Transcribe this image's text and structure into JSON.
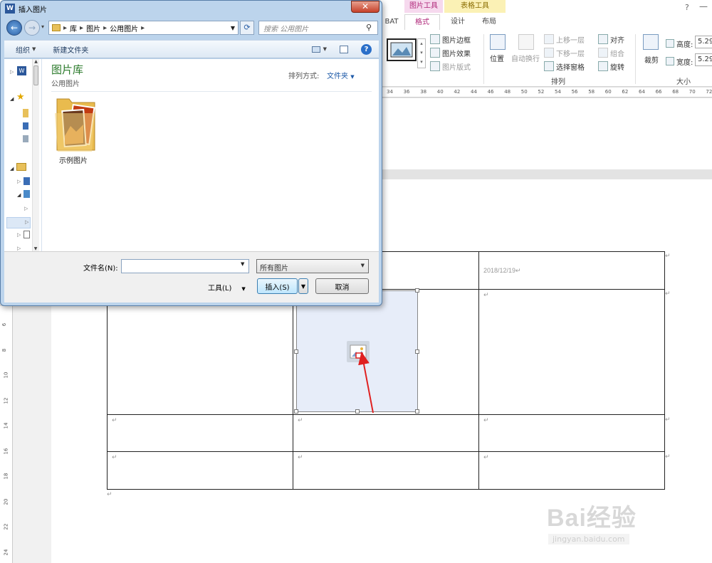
{
  "ribbon": {
    "context_picture_tools": "图片工具",
    "context_table_tools": "表格工具",
    "tabs": {
      "bat": "BAT",
      "format": "格式",
      "design": "设计",
      "layout": "布局"
    },
    "help": "?",
    "picture_border": "图片边框",
    "picture_effects": "图片效果",
    "picture_layout": "图片版式",
    "position": "位置",
    "wrap_text": "自动换行",
    "bring_forward": "上移一层",
    "send_backward": "下移一层",
    "selection_pane": "选择窗格",
    "align": "对齐",
    "group": "组合",
    "rotate": "旋转",
    "arrange_label": "排列",
    "crop": "裁剪",
    "height_label": "高度:",
    "width_label": "宽度:",
    "height_value": "5.29",
    "width_value": "5.29",
    "size_label": "大小"
  },
  "ruler": {
    "h_numbers": [
      "34",
      "36",
      "38",
      "40",
      "42",
      "44",
      "46",
      "48",
      "50",
      "52",
      "54",
      "56",
      "58",
      "60",
      "62",
      "64",
      "66",
      "68",
      "70",
      "72"
    ],
    "v_numbers": [
      "6",
      "8",
      "10",
      "12",
      "14",
      "16",
      "18",
      "20",
      "22",
      "24"
    ]
  },
  "document": {
    "date_text": "2018/12/19",
    "para_mark": "↵"
  },
  "dialog": {
    "title": "插入图片",
    "breadcrumb": [
      "库",
      "图片",
      "公用图片"
    ],
    "search_placeholder": "搜索 公用图片",
    "organize": "组织",
    "new_folder": "新建文件夹",
    "library_title": "图片库",
    "library_subtitle": "公用图片",
    "sort_label": "排列方式:",
    "sort_value": "文件夹",
    "folder_name": "示例图片",
    "filename_label": "文件名(N):",
    "filename_value": "",
    "filter_value": "所有图片",
    "tools_label": "工具(L)",
    "insert_label": "插入(S)",
    "cancel_label": "取消"
  },
  "watermark": {
    "brand": "Bai经验",
    "url": "jingyan.baidu.com"
  },
  "colors": {
    "accent_red": "#e02020",
    "title_green": "#2b7a2b",
    "link_blue": "#1e5aa8"
  }
}
